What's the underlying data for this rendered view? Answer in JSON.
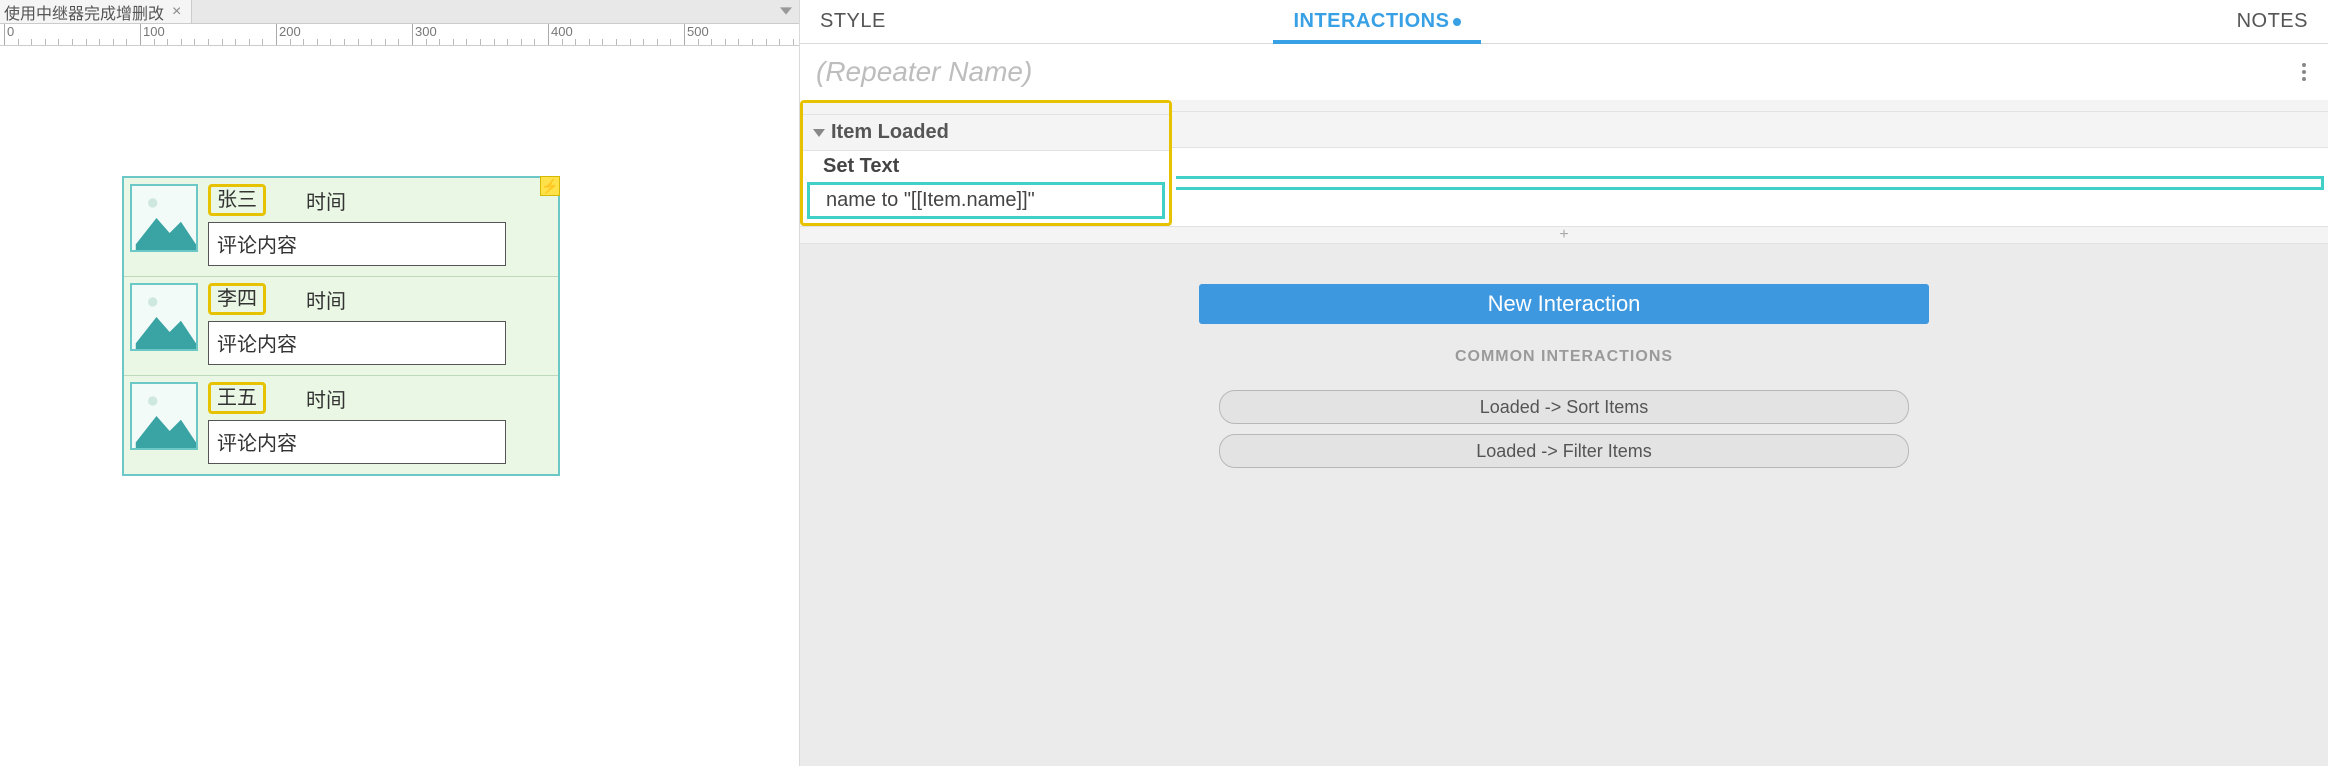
{
  "tab": {
    "title": "使用中继器完成增删改"
  },
  "ruler": {
    "majors": [
      0,
      100,
      200,
      300,
      400,
      500
    ]
  },
  "repeater": {
    "badge": "⚡",
    "rows": [
      {
        "name": "张三",
        "time": "时间",
        "content": "评论内容"
      },
      {
        "name": "李四",
        "time": "时间",
        "content": "评论内容"
      },
      {
        "name": "王五",
        "time": "时间",
        "content": "评论内容"
      }
    ]
  },
  "inspector": {
    "tabs": {
      "style": "STYLE",
      "interactions": "INTERACTIONS",
      "notes": "NOTES"
    },
    "name_placeholder": "(Repeater Name)",
    "event": "Item Loaded",
    "action": "Set Text",
    "action_line": "name to \"[[Item.name]]\"",
    "add": "+",
    "new_btn": "New Interaction",
    "common_label": "COMMON INTERACTIONS",
    "common": {
      "sort": "Loaded -> Sort Items",
      "filter": "Loaded -> Filter Items"
    }
  }
}
